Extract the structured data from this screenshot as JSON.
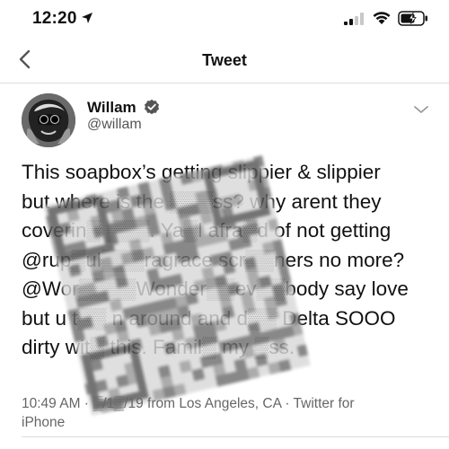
{
  "status_bar": {
    "time": "12:20",
    "icons": [
      "location-arrow-icon",
      "cellular-signal-icon",
      "wifi-icon",
      "battery-charging-icon"
    ]
  },
  "nav": {
    "title": "Tweet",
    "back_icon": "chevron-left-icon"
  },
  "tweet": {
    "author": {
      "display_name": "Willam",
      "handle": "@willam",
      "verified": true
    },
    "menu_icon": "chevron-down-icon",
    "text_lines": [
      "This soapbox’s getting slippier & slippier",
      "but where is the ▒▒▒ss? why arent they",
      "coverin▒ ▒▒▒. Ya▒l afra▒d of not getting",
      "@rup▒ul▒▒▒ragrace scr▒▒ners no more?",
      "@Wor▒▒▒▒Wonder▒▒ev▒▒body say love",
      "but u t▒▒ n around and d▒▒ Delta SOOO",
      "dirty wit▒ this. Famil▒ my ▒ss."
    ],
    "meta": {
      "line1": "10:49 AM · ▒/1▒/19 from Los Angeles, CA · Twitter for",
      "line2": "iPhone"
    }
  },
  "colors": {
    "text": "#111111",
    "secondary_text": "#666666",
    "divider": "#dddddd",
    "background": "#ffffff"
  }
}
